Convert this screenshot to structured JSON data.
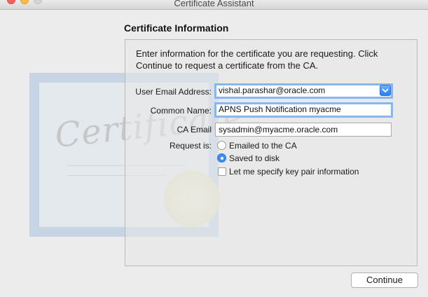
{
  "window": {
    "title": "Certificate Assistant"
  },
  "decor": {
    "certificate_word": "Certificate"
  },
  "section": {
    "heading": "Certificate Information"
  },
  "form": {
    "intro": "Enter information for the certificate you are requesting. Click Continue to request a certificate from the CA.",
    "user_email": {
      "label": "User Email Address:",
      "value": "vishal.parashar@oracle.com"
    },
    "common_name": {
      "label": "Common Name:",
      "value": "APNS Push Notification myacme"
    },
    "ca_email": {
      "label": "CA Email",
      "value": "sysadmin@myacme.oracle.com"
    },
    "request": {
      "label": "Request is:",
      "options": [
        {
          "label": "Emailed to the CA",
          "selected": false
        },
        {
          "label": "Saved to disk",
          "selected": true
        }
      ]
    },
    "key_pair": {
      "label": "Let me specify key pair information",
      "checked": false
    }
  },
  "footer": {
    "continue_label": "Continue"
  },
  "colors": {
    "accent": "#3b8ff4",
    "focus_ring": "#8ab6eb"
  }
}
